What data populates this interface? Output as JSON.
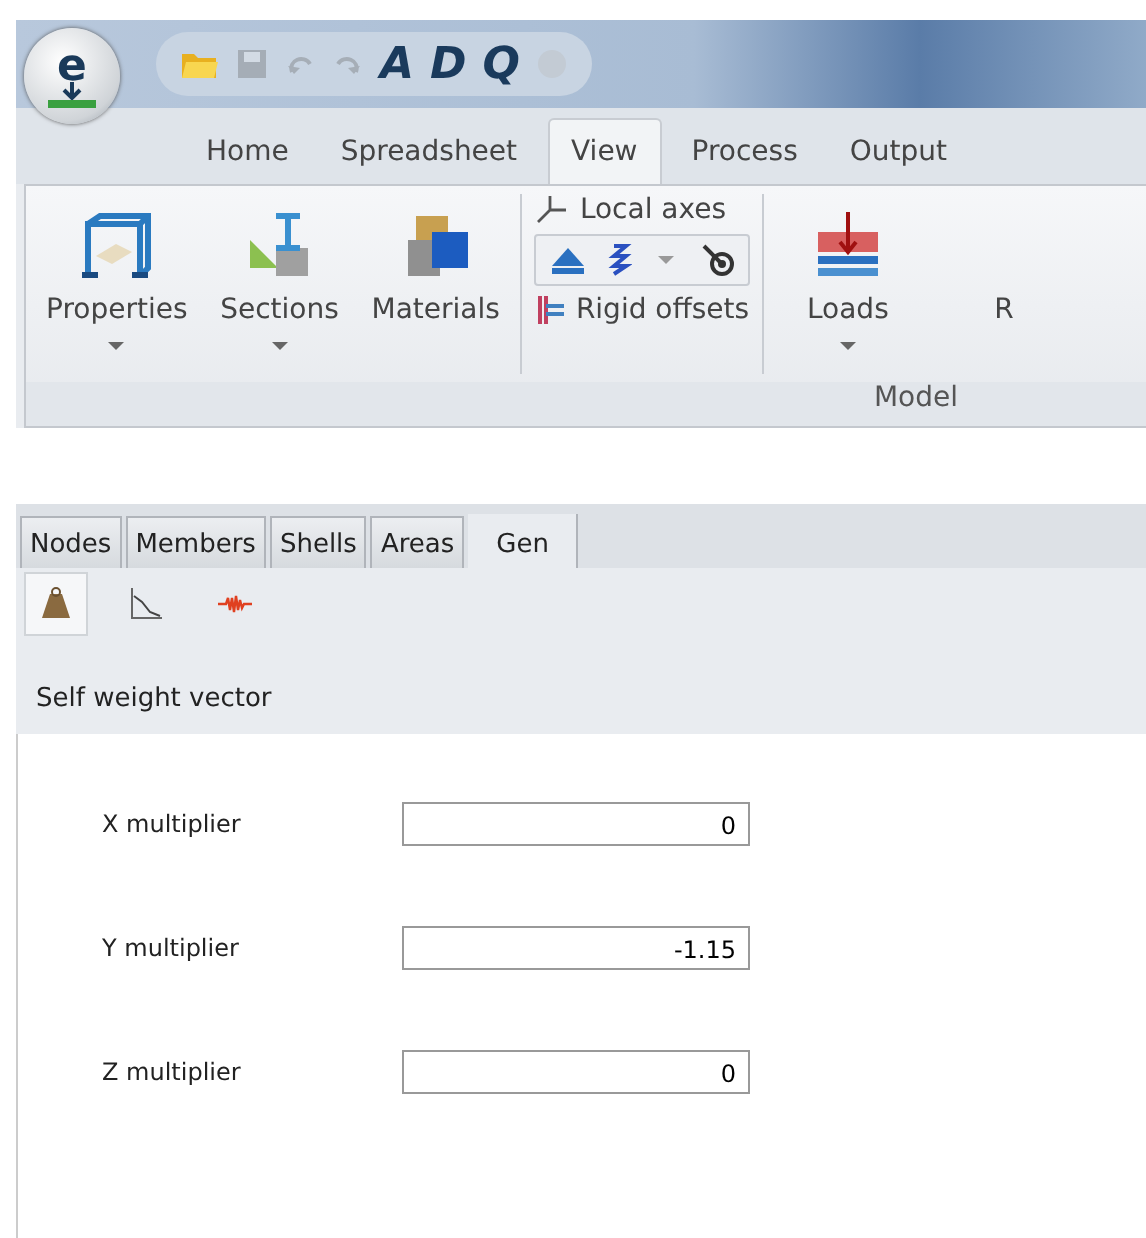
{
  "app_logo": "e",
  "quick_access": [
    {
      "kind": "open",
      "disabled": false
    },
    {
      "kind": "save",
      "disabled": true
    },
    {
      "kind": "undo",
      "disabled": true
    },
    {
      "kind": "redo",
      "disabled": true
    },
    {
      "kind": "letter",
      "label": "A",
      "disabled": false
    },
    {
      "kind": "letter",
      "label": "D",
      "disabled": false
    },
    {
      "kind": "letter",
      "label": "Q",
      "disabled": false
    },
    {
      "kind": "stop",
      "disabled": true
    }
  ],
  "ribbon_tabs": [
    {
      "label": "Home",
      "selected": false
    },
    {
      "label": "Spreadsheet",
      "selected": false
    },
    {
      "label": "View",
      "selected": true
    },
    {
      "label": "Process",
      "selected": false
    },
    {
      "label": "Output",
      "selected": false
    }
  ],
  "ribbon_items": [
    {
      "kind": "properties",
      "label": "Properties",
      "dropdown": true
    },
    {
      "kind": "sections",
      "label": "Sections",
      "dropdown": true
    },
    {
      "kind": "materials",
      "label": "Materials",
      "dropdown": false
    },
    {
      "kind": "stack",
      "local_axes": "Local axes",
      "rigid_offsets": "Rigid offsets"
    },
    {
      "kind": "loads",
      "label": "Loads",
      "dropdown": true
    },
    {
      "kind": "cut",
      "label": "R",
      "dropdown": false
    }
  ],
  "ribbon_group": "Model",
  "panel_tabs": [
    {
      "label": "Nodes",
      "selected": false
    },
    {
      "label": "Members",
      "selected": false
    },
    {
      "label": "Shells",
      "selected": false
    },
    {
      "label": "Areas",
      "selected": false
    },
    {
      "label": "Gen",
      "selected": true
    }
  ],
  "tools": [
    {
      "kind": "weight",
      "selected": true
    },
    {
      "kind": "curve",
      "selected": false
    },
    {
      "kind": "seismic",
      "selected": false
    }
  ],
  "section_title": "Self weight vector",
  "fields": [
    {
      "label": "X multiplier",
      "value": "0"
    },
    {
      "label": "Y multiplier",
      "value": "-1.15"
    },
    {
      "label": "Z multiplier",
      "value": "0"
    }
  ]
}
